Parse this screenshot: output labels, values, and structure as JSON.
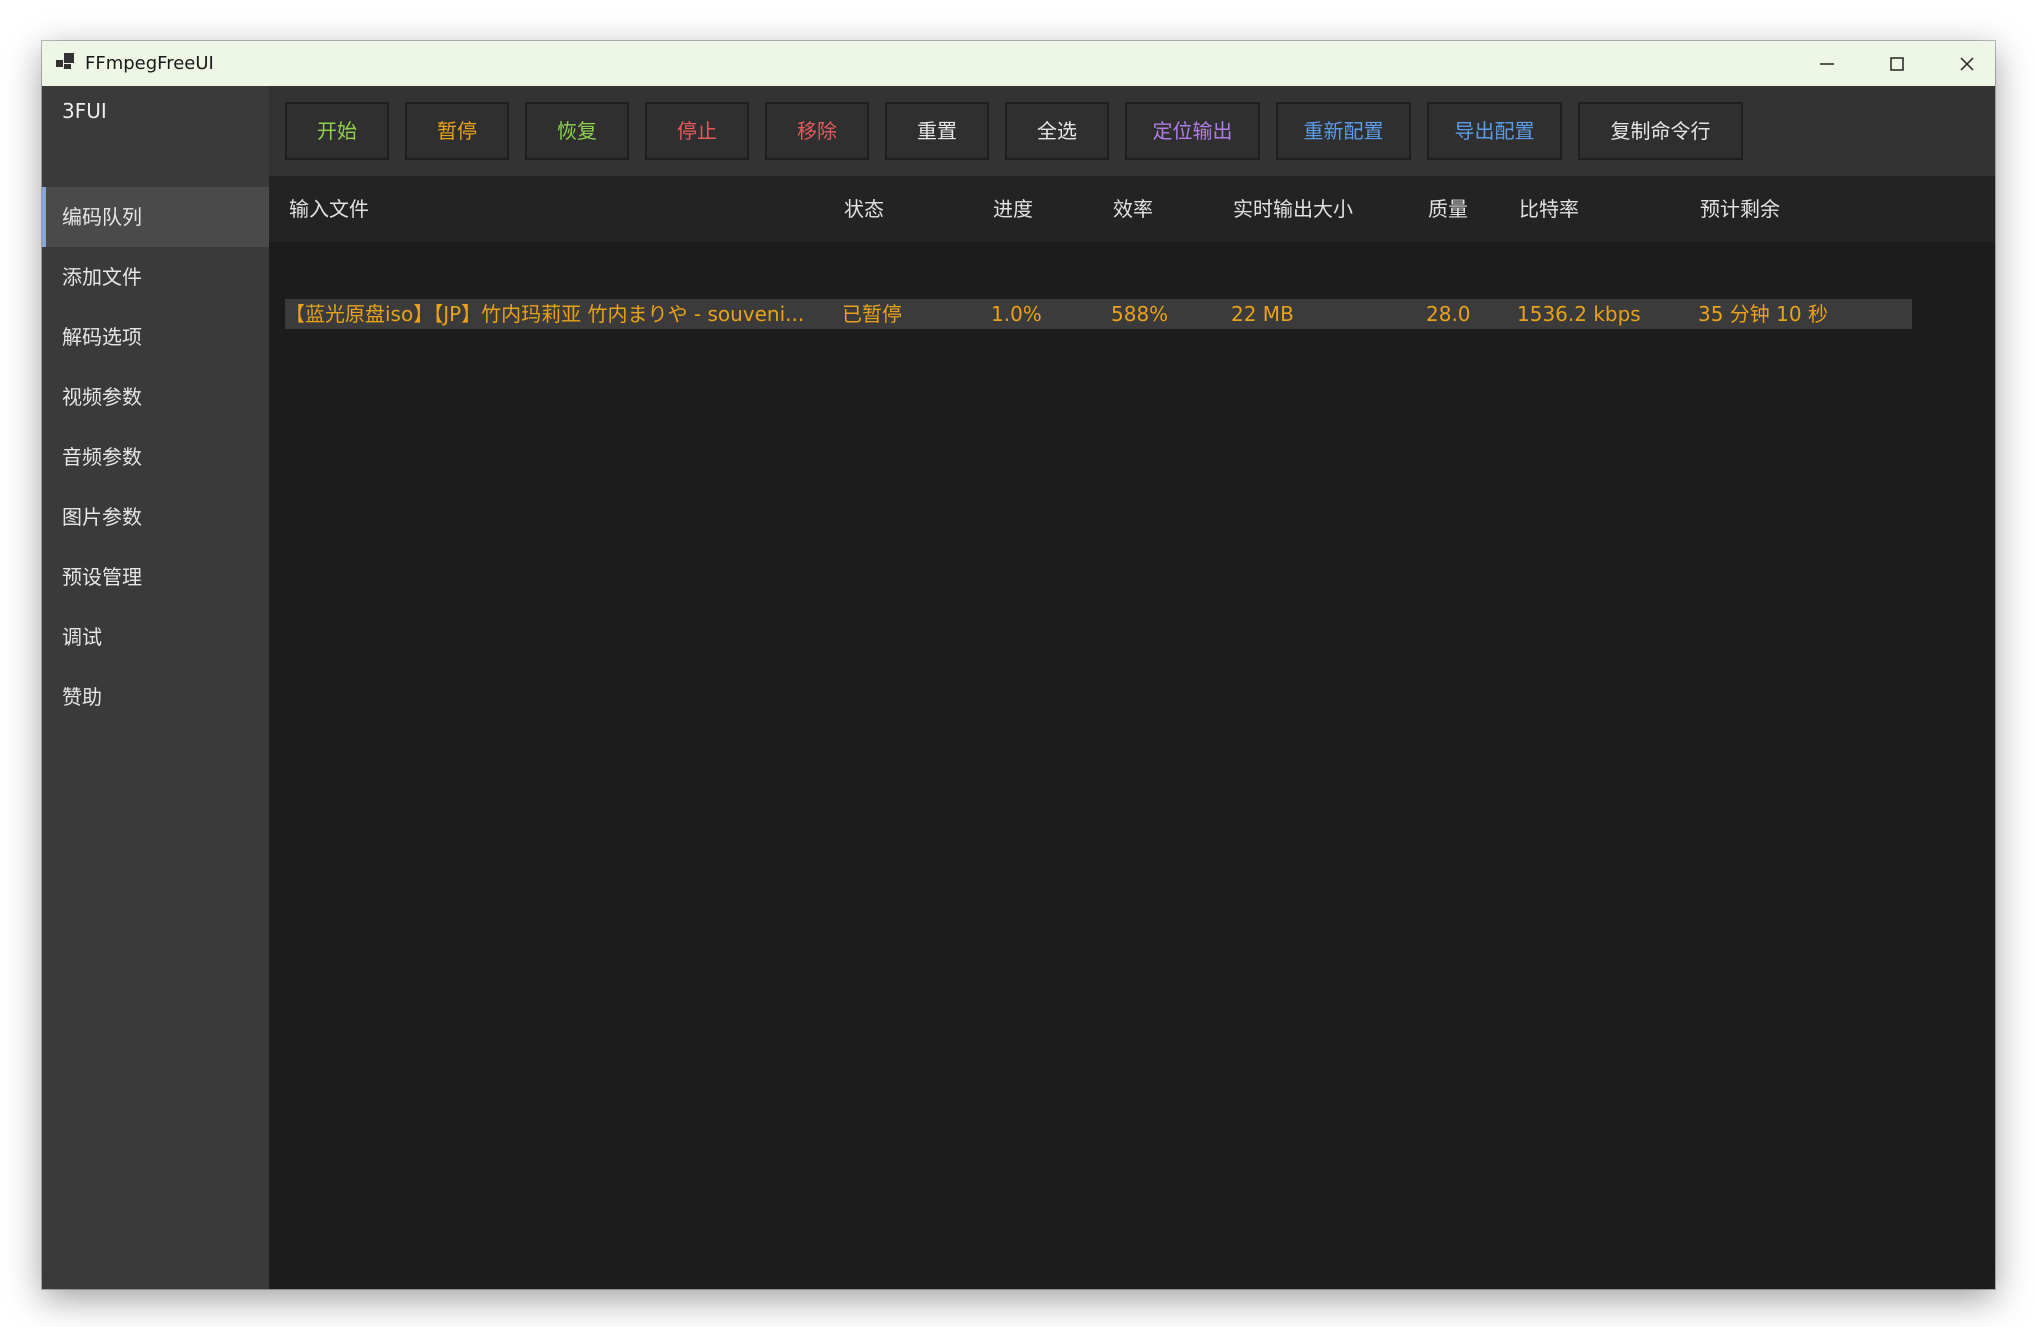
{
  "window": {
    "title": "FFmpegFreeUI"
  },
  "sidebar": {
    "app_name": "3FUI",
    "items": [
      {
        "label": "编码队列",
        "active": true
      },
      {
        "label": "添加文件"
      },
      {
        "label": "解码选项"
      },
      {
        "label": "视频参数"
      },
      {
        "label": "音频参数"
      },
      {
        "label": "图片参数"
      },
      {
        "label": "预设管理"
      },
      {
        "label": "调试"
      },
      {
        "label": "赞助"
      }
    ]
  },
  "toolbar": {
    "buttons": [
      {
        "label": "开始",
        "color": "#8fd14f"
      },
      {
        "label": "暂停",
        "color": "#e8a21b"
      },
      {
        "label": "恢复",
        "color": "#8fd14f"
      },
      {
        "label": "停止",
        "color": "#e35b5b"
      },
      {
        "label": "移除",
        "color": "#e35b5b"
      },
      {
        "label": "重置",
        "color": "#e6e6e6"
      },
      {
        "label": "全选",
        "color": "#e6e6e6"
      },
      {
        "label": "定位输出",
        "color": "#b07ce6"
      },
      {
        "label": "重新配置",
        "color": "#5c9be6"
      },
      {
        "label": "导出配置",
        "color": "#5c9be6"
      },
      {
        "label": "复制命令行",
        "color": "#e6e6e6"
      }
    ]
  },
  "queue": {
    "columns": [
      "输入文件",
      "状态",
      "进度",
      "效率",
      "实时输出大小",
      "质量",
      "比特率",
      "预计剩余"
    ],
    "rows": [
      {
        "input": "【蓝光原盘iso】【JP】竹内玛莉亚 竹内まりや - souveni...",
        "status": "已暂停",
        "progress": "1.0%",
        "efficiency": "588%",
        "size": "22 MB",
        "quality": "28.0",
        "bitrate": "1536.2 kbps",
        "remaining": "35 分钟 10 秒"
      }
    ]
  }
}
